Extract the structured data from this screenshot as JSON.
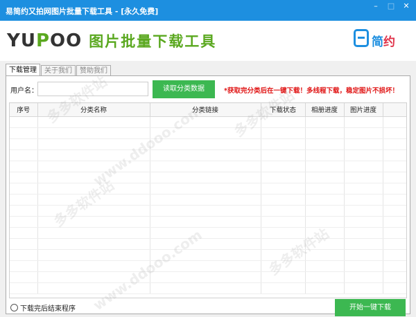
{
  "window": {
    "title": "易简约又拍网图片批量下载工具 - [永久免费]",
    "min_icon": "minimize-icon",
    "max_icon": "maximize-icon",
    "close_icon": "close-icon"
  },
  "header": {
    "logo_prefix": "YU",
    "logo_p": "P",
    "logo_suffix": "OO",
    "tool_name": "图片批量下载工具",
    "brand_part1": "简",
    "brand_part2": "约",
    "brand_icon": "easy-logo-icon",
    "accent_color": "#1d8fe0",
    "green_color": "#5aa81f"
  },
  "tabs": [
    {
      "label": "下载管理",
      "active": true
    },
    {
      "label": "关于我们",
      "active": false
    },
    {
      "label": "赞助我们",
      "active": false
    }
  ],
  "form": {
    "user_label": "用户名：",
    "user_value": "",
    "read_button": "读取分类数据",
    "notice": "*获取完分类后在一键下载！多线程下载，稳定图片不损坏！"
  },
  "table": {
    "columns": [
      "序号",
      "分类名称",
      "分类链接",
      "下载状态",
      "相册进度",
      "图片进度",
      ""
    ],
    "rows": []
  },
  "footer": {
    "radio_label": "下载完后结束程序",
    "radio_checked": false,
    "start_button": "开始一键下载"
  },
  "watermarks": [
    "多多软件站",
    "www.ddooo.com"
  ]
}
